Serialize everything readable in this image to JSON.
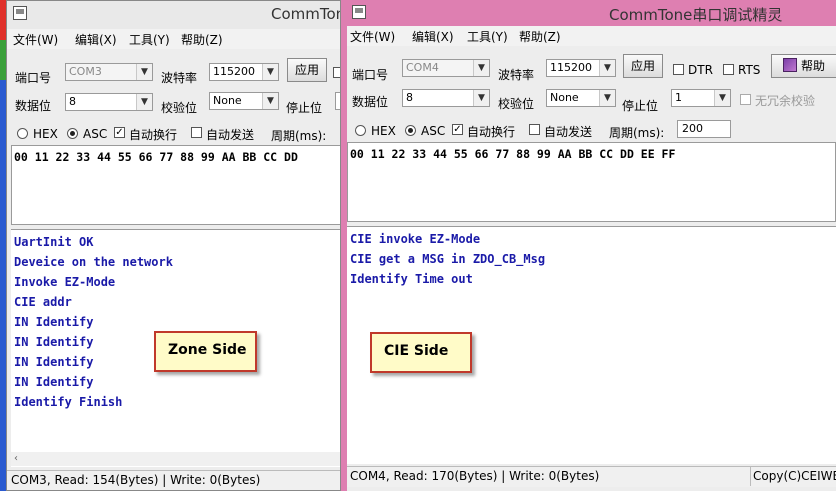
{
  "left_window": {
    "title": "CommTone",
    "menu": [
      "文件(W)",
      "编辑(X)",
      "工具(Y)",
      "帮助(Z)"
    ],
    "port_label": "端口号",
    "port_value": "COM3",
    "baud_label": "波特率",
    "baud_value": "115200",
    "apply_label": "应用",
    "databits_label": "数据位",
    "databits_value": "8",
    "parity_label": "校验位",
    "parity_value": "None",
    "stopbits_label": "停止位",
    "hex_label": "HEX",
    "asc_label": "ASC",
    "autowrap_label": "自动换行",
    "autosend_label": "自动发送",
    "period_label": "周期(ms):",
    "send_text": "00 11 22 33 44 55 66 77 88 99 AA BB CC DD",
    "receive_lines": [
      "UartInit OK",
      "Deveice on the network",
      "Invoke EZ-Mode",
      "CIE addr",
      "IN Identify",
      "IN Identify",
      "IN Identify",
      "IN Identify",
      "Identify Finish"
    ],
    "callout": "Zone Side",
    "status": "COM3, Read: 154(Bytes) | Write: 0(Bytes)"
  },
  "right_window": {
    "title": "CommTone串口调试精灵",
    "menu": [
      "文件(W)",
      "编辑(X)",
      "工具(Y)",
      "帮助(Z)"
    ],
    "port_label": "端口号",
    "port_value": "COM4",
    "baud_label": "波特率",
    "baud_value": "115200",
    "apply_label": "应用",
    "dtr_label": "DTR",
    "rts_label": "RTS",
    "help_label": "帮助",
    "databits_label": "数据位",
    "databits_value": "8",
    "parity_label": "校验位",
    "parity_value": "None",
    "stopbits_label": "停止位",
    "stopbits_value": "1",
    "no_redundant_label": "无冗余校验",
    "hex_label": "HEX",
    "asc_label": "ASC",
    "autowrap_label": "自动换行",
    "autosend_label": "自动发送",
    "period_label": "周期(ms):",
    "period_value": "200",
    "send_text": "00 11 22 33 44 55 66 77 88 99 AA BB CC DD EE FF",
    "receive_lines": [
      "CIE invoke EZ-Mode",
      "CIE get a MSG in ZDO_CB_Msg",
      "Identify Time out"
    ],
    "callout": "CIE Side",
    "status": "COM4, Read: 170(Bytes) | Write: 0(Bytes)",
    "copyright": "Copy(C)CEIWE"
  }
}
